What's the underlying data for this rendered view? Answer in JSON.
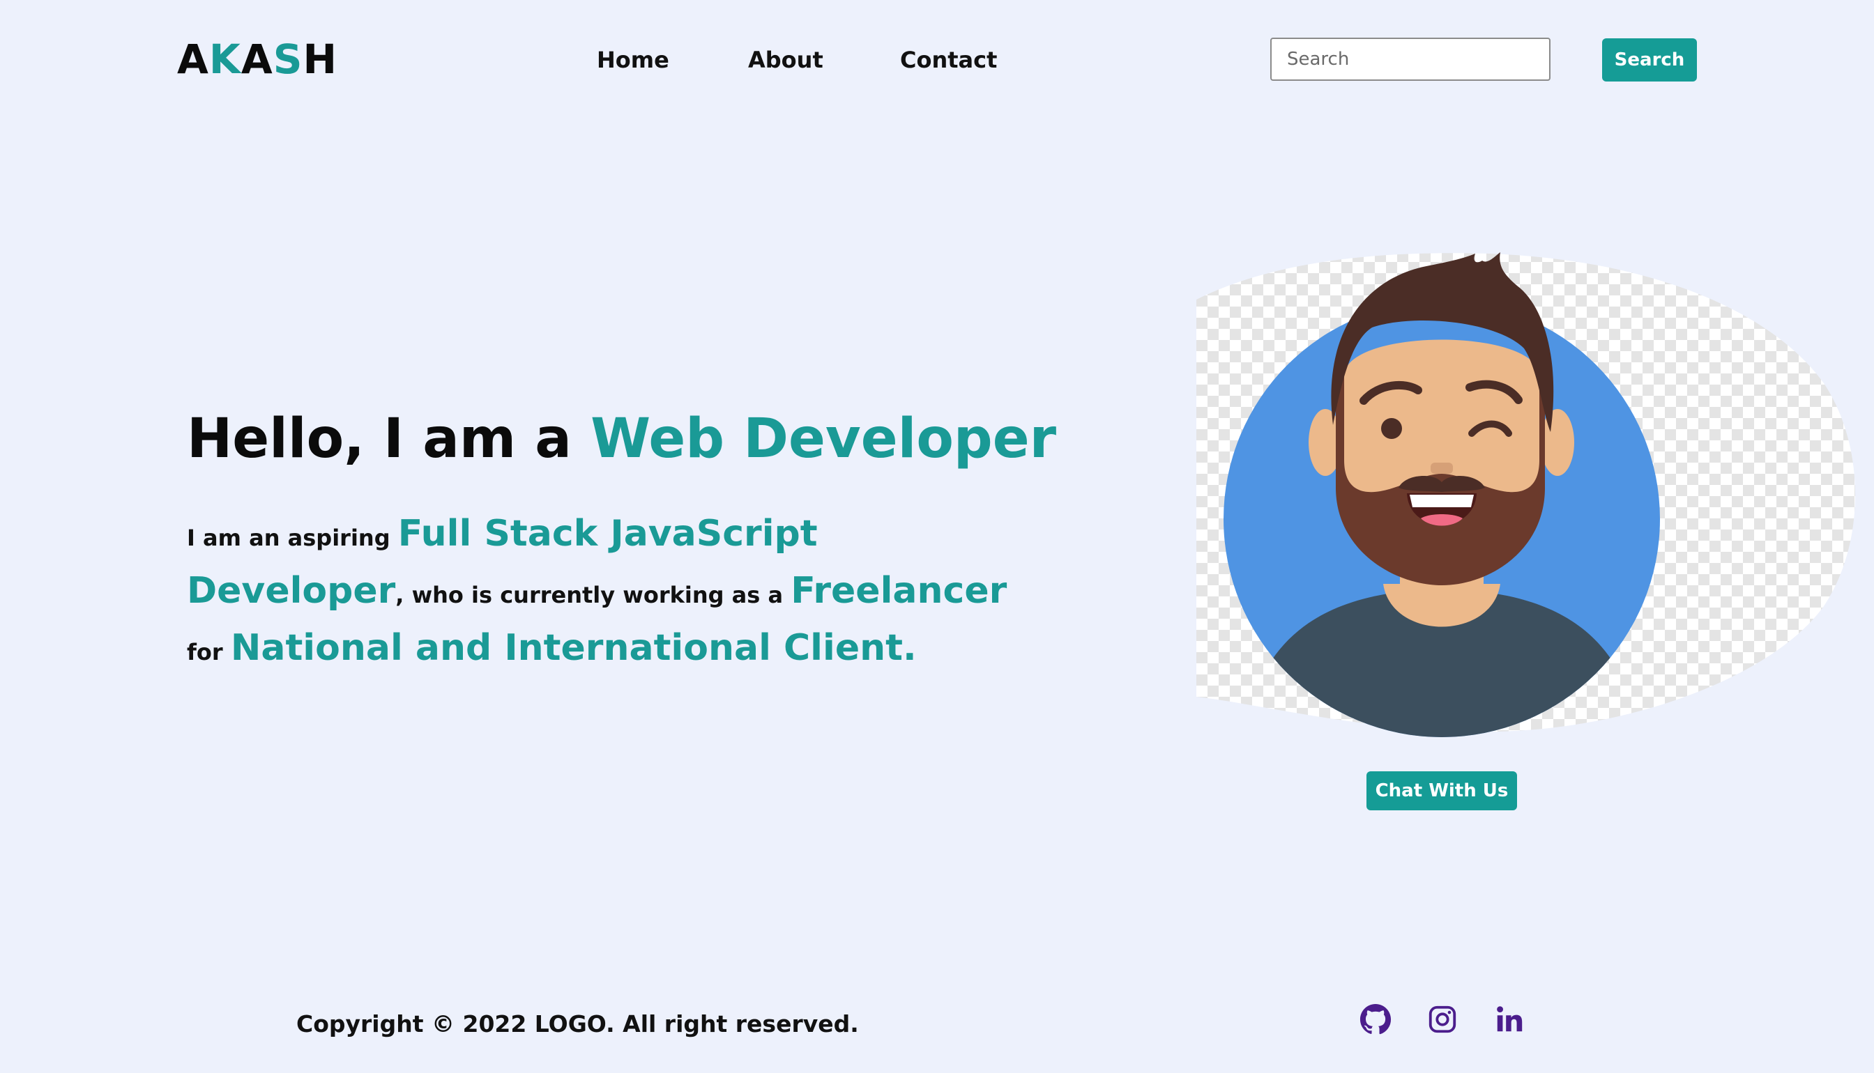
{
  "header": {
    "logo": [
      "A",
      "K",
      "A",
      "S",
      "H"
    ],
    "nav": {
      "home": "Home",
      "about": "About",
      "contact": "Contact"
    },
    "search": {
      "placeholder": "Search",
      "value": "",
      "button_label": "Search"
    }
  },
  "hero": {
    "title_prefix": "Hello, I am a ",
    "title_highlight": "Web Developer",
    "desc_part1": "I am an aspiring ",
    "desc_highlight1": "Full Stack JavaScript Developer",
    "desc_part2": ", who is currently working as a ",
    "desc_highlight2": "Freelancer",
    "desc_part3": " for ",
    "desc_highlight3": "National and International Client."
  },
  "avatar": {
    "chat_button_label": "Chat With Us"
  },
  "footer": {
    "copyright": "Copyright © 2022 LOGO. All right reserved.",
    "social_icons": [
      "github-icon",
      "instagram-icon",
      "linkedin-icon"
    ]
  },
  "colors": {
    "background": "#edf1fc",
    "accent": "#1a9a96",
    "button": "#159c96",
    "social_icon": "#4b1d8c",
    "avatar_circle": "#4f94e3",
    "shirt": "#3c4f5e",
    "skin": "#ecb98b",
    "hair": "#4b2d26"
  }
}
